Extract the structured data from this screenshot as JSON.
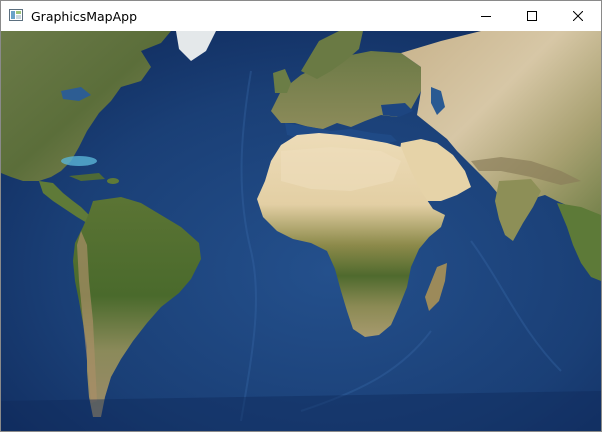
{
  "window": {
    "title": "GraphicsMapApp",
    "icon": "app-window-icon",
    "controls": [
      {
        "name": "minimize-button",
        "icon": "minimize-icon"
      },
      {
        "name": "maximize-button",
        "icon": "maximize-icon"
      },
      {
        "name": "close-button",
        "icon": "close-icon"
      }
    ]
  },
  "map": {
    "basemap": "satellite-imagery",
    "colors": {
      "ocean_deep": "#0f2a5c",
      "ocean": "#1f4a86",
      "shallow": "#3f8ec4",
      "forest": "#4a6a2c",
      "grassland": "#7d8a48",
      "desert": "#e3cfa4",
      "mountain": "#b9a27a",
      "ice": "#e8ecef"
    }
  }
}
